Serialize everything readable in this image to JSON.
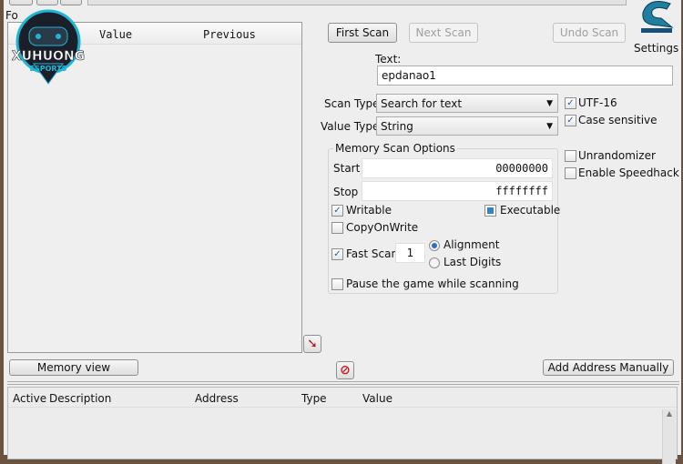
{
  "logo": {
    "text": "XUHUONG",
    "sub": "ESPORTS"
  },
  "found_label": "Fo",
  "results": {
    "columns": [
      "Value",
      "Previous"
    ]
  },
  "scan": {
    "first": "First Scan",
    "next": "Next Scan",
    "undo": "Undo Scan",
    "settings": "Settings"
  },
  "text_label": "Text:",
  "text_value": "epdanao1",
  "scan_type": {
    "label": "Scan Type",
    "value": "Search for text"
  },
  "value_type": {
    "label": "Value Type",
    "value": "String"
  },
  "utf16": {
    "label": "UTF-16",
    "checked": true
  },
  "case_sensitive": {
    "label": "Case sensitive",
    "checked": true
  },
  "unrandomizer": {
    "label": "Unrandomizer",
    "checked": false
  },
  "speedhack": {
    "label": "Enable Speedhack",
    "checked": false
  },
  "memory_options": {
    "title": "Memory Scan Options",
    "start_label": "Start",
    "start_value": "00000000",
    "stop_label": "Stop",
    "stop_value": "ffffffff",
    "writable": "Writable",
    "executable": "Executable",
    "copyonwrite": "CopyOnWrite",
    "fast_scan": "Fast Scan",
    "fast_scan_value": "1",
    "alignment": "Alignment",
    "last_digits": "Last Digits",
    "pause": "Pause the game while scanning"
  },
  "memory_view": "Memory view",
  "add_address": "Add Address Manually",
  "address_list": {
    "columns": [
      "Active",
      "Description",
      "Address",
      "Type",
      "Value"
    ]
  },
  "colors": {
    "accent": "#2b6fc0",
    "logo": "#1fb6d6"
  }
}
